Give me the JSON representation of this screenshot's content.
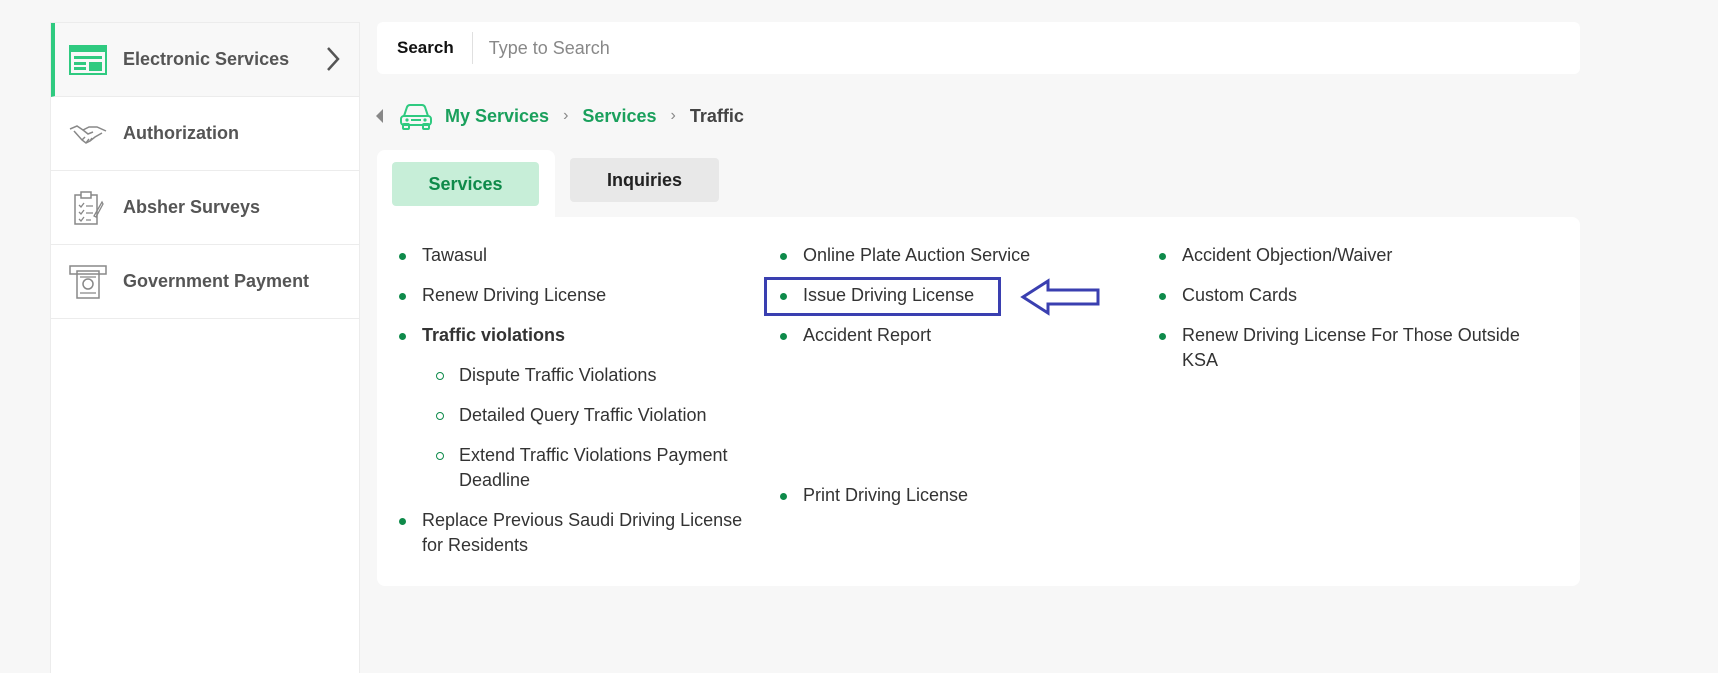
{
  "sidebar": {
    "items": [
      {
        "label": "Electronic Services",
        "icon": "browser-window-icon",
        "active": true
      },
      {
        "label": "Authorization",
        "icon": "handshake-icon"
      },
      {
        "label": "Absher Surveys",
        "icon": "clipboard-checklist-icon"
      },
      {
        "label": "Government Payment",
        "icon": "atm-cash-icon"
      }
    ]
  },
  "search": {
    "label": "Search",
    "placeholder": "Type to Search"
  },
  "breadcrumb": {
    "items": [
      "My Services",
      "Services",
      "Traffic"
    ]
  },
  "tabs": {
    "services": "Services",
    "inquiries": "Inquiries"
  },
  "services": {
    "col1": {
      "tawasul": "Tawasul",
      "renew": "Renew Driving License",
      "violations": "Traffic violations",
      "sub": [
        "Dispute Traffic Violations",
        "Detailed Query Traffic Violation",
        "Extend Traffic Violations Payment Deadline"
      ],
      "replace": "Replace Previous Saudi Driving License for Residents"
    },
    "col2": {
      "auction": "Online Plate Auction Service",
      "issue": "Issue Driving License",
      "accident": "Accident Report",
      "print": "Print Driving License"
    },
    "col3": {
      "objection": "Accident Objection/Waiver",
      "custom": "Custom Cards",
      "renew_outside": "Renew Driving License For Those Outside KSA"
    }
  },
  "colors": {
    "accent": "#1aa05c",
    "active_tab_bg": "#c7eed8",
    "annotation": "#3a3fb0"
  }
}
